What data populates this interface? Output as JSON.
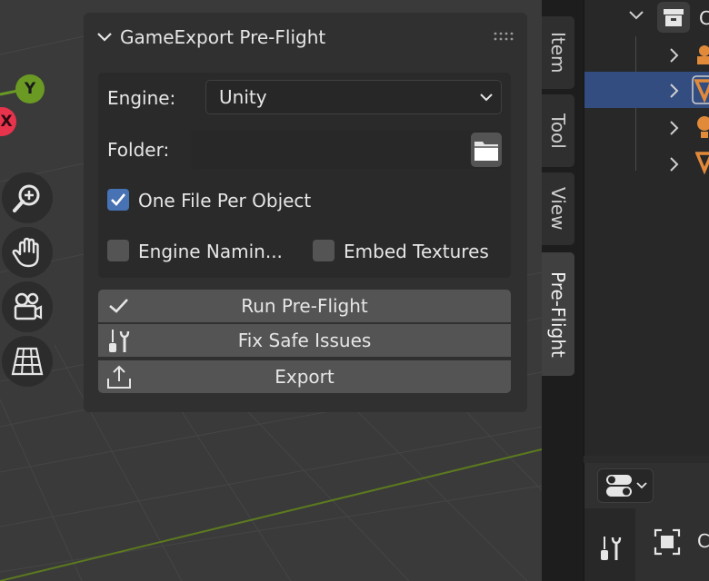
{
  "panel": {
    "title": "GameExport Pre-Flight",
    "engine_label": "Engine:",
    "engine_value": "Unity",
    "folder_label": "Folder:",
    "folder_value": "",
    "one_file_label": "One File Per Object",
    "one_file_checked": true,
    "engine_naming_label": "Engine Namin...",
    "engine_naming_checked": false,
    "embed_textures_label": "Embed Textures",
    "embed_textures_checked": false,
    "buttons": {
      "run": "Run Pre-Flight",
      "fix": "Fix Safe Issues",
      "export": "Export"
    }
  },
  "gizmo": {
    "y_label": "Y",
    "x_label": "X",
    "y_color": "#6a9a23",
    "x_color": "#e8334d"
  },
  "tabs": [
    "Item",
    "Tool",
    "View",
    "Pre-Flight"
  ],
  "active_tab": "Pre-Flight",
  "outliner": {
    "header_partial": "C"
  },
  "properties": {
    "partial_text": "C"
  },
  "colors": {
    "accent": "#4772b3",
    "selection": "#334d80"
  }
}
